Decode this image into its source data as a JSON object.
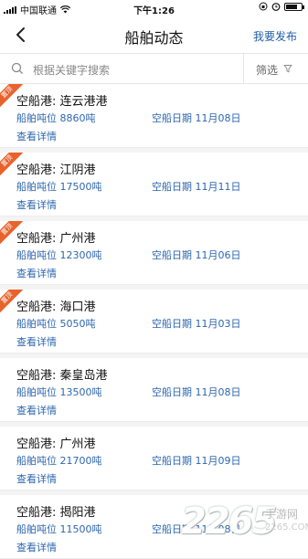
{
  "statusbar": {
    "carrier": "中国联通",
    "time": "下午1:26"
  },
  "navbar": {
    "back_icon": "chevron-left-icon",
    "title": "船舶动态",
    "publish_label": "我要发布"
  },
  "search": {
    "placeholder": "根据关键字搜索",
    "filter_label": "筛选",
    "filter_icon": "funnel-icon"
  },
  "colors": {
    "accent_blue": "#2d66ad",
    "ribbon_orange": "#e8622c"
  },
  "listings": [
    {
      "badge": "置顶",
      "port_text": "空船港: 连云港港",
      "tonnage_text": "船舶吨位 8860吨",
      "date_text": "空船日期 11月08日",
      "detail_label": "查看详情"
    },
    {
      "badge": "置顶",
      "port_text": "空船港: 江阴港",
      "tonnage_text": "船舶吨位 17500吨",
      "date_text": "空船日期 11月11日",
      "detail_label": "查看详情"
    },
    {
      "badge": "置顶",
      "port_text": "空船港: 广州港",
      "tonnage_text": "船舶吨位 12300吨",
      "date_text": "空船日期 11月06日",
      "detail_label": "查看详情"
    },
    {
      "badge": "置顶",
      "port_text": "空船港: 海口港",
      "tonnage_text": "船舶吨位 5050吨",
      "date_text": "空船日期 11月03日",
      "detail_label": "查看详情"
    },
    {
      "badge": "",
      "port_text": "空船港: 秦皇岛港",
      "tonnage_text": "船舶吨位 13500吨",
      "date_text": "空船日期 11月08日",
      "detail_label": "查看详情"
    },
    {
      "badge": "",
      "port_text": "空船港: 广州港",
      "tonnage_text": "船舶吨位 21700吨",
      "date_text": "空船日期 11月09日",
      "detail_label": "查看详情"
    },
    {
      "badge": "",
      "port_text": "空船港: 揭阳港",
      "tonnage_text": "船舶吨位 11500吨",
      "date_text": "空船日期 11月08日",
      "detail_label": "查看详情"
    }
  ],
  "watermark": {
    "number": "2265",
    "site_name": "手游网",
    "url": "2265.COM"
  }
}
